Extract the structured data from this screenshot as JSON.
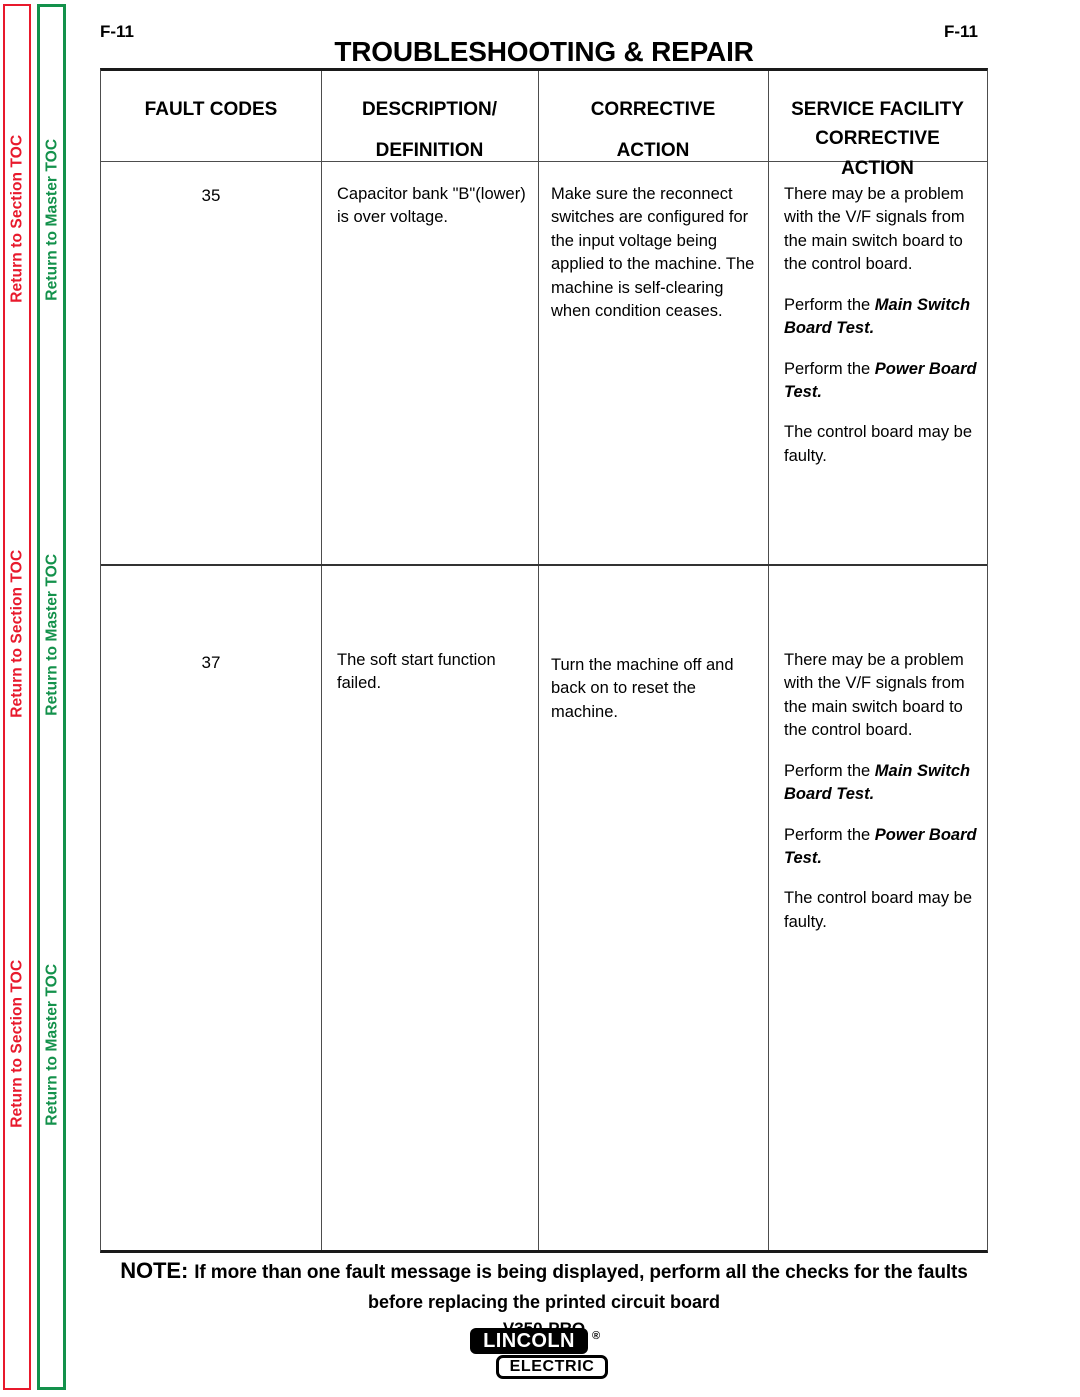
{
  "sidebar": {
    "strips": [
      {
        "name": "section-toc",
        "label": "Return to Section TOC",
        "color": "#e8192c",
        "repeats": 3
      },
      {
        "name": "master-toc",
        "label": "Return to Master TOC",
        "color": "#13914b",
        "repeats": 3
      }
    ]
  },
  "header": {
    "page_number_left": "F-11",
    "page_number_right": "F-11",
    "title": "TROUBLESHOOTING & REPAIR"
  },
  "table": {
    "columns": [
      {
        "line1": "FAULT CODES",
        "line2": ""
      },
      {
        "line1": "DESCRIPTION/",
        "line2": "DEFINITION"
      },
      {
        "line1": "CORRECTIVE",
        "line2": "ACTION"
      },
      {
        "line1": "SERVICE FACILITY",
        "line2": "CORRECTIVE",
        "line3": "ACTION"
      }
    ],
    "rows": [
      {
        "fault_code": "35",
        "description": "Capacitor bank \"B\"(lower) is over voltage.",
        "corrective_action": "Make sure the reconnect switches are configured for the input voltage being applied to the machine.  The machine is self-clearing when condition ceases.",
        "service_facility": [
          {
            "text": "There may be a problem with the V/F signals from the main switch board to the control board.",
            "emphasis": ""
          },
          {
            "text": "Perform the ",
            "emphasis": "Main Switch Board Test."
          },
          {
            "text": "Perform the ",
            "emphasis": "Power Board Test."
          },
          {
            "text": "The control board may be faulty.",
            "emphasis": ""
          }
        ]
      },
      {
        "fault_code": "37",
        "description": "The soft start function failed.",
        "corrective_action": "Turn the machine off and back on to reset the machine.",
        "service_facility": [
          {
            "text": "There may be a problem with the V/F signals from the main switch board to the control board.",
            "emphasis": ""
          },
          {
            "text": "Perform the ",
            "emphasis": "Main Switch Board Test."
          },
          {
            "text": "Perform the ",
            "emphasis": "Power Board Test."
          },
          {
            "text": "The control board may be faulty.",
            "emphasis": ""
          }
        ]
      }
    ]
  },
  "footer": {
    "note_keyword": "NOTE:",
    "note_line1": "If more than one fault message is being displayed, perform all the checks for the faults",
    "note_line2": "before replacing the printed circuit board",
    "model": "V350-PRO",
    "logo": {
      "top_text": "LINCOLN",
      "registered": "®",
      "bottom_text": "ELECTRIC"
    }
  }
}
